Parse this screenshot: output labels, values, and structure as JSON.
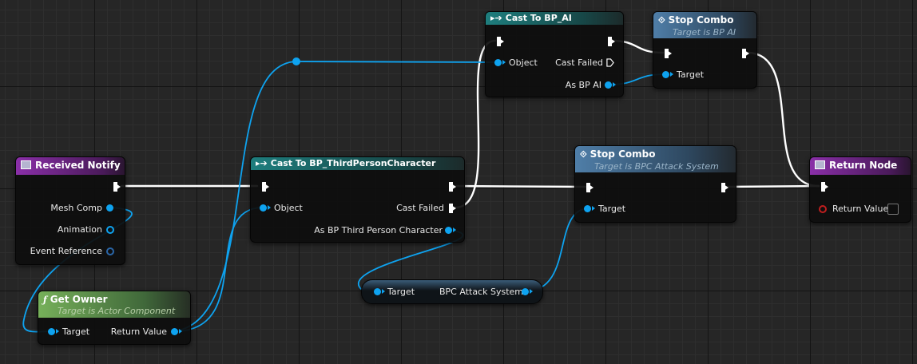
{
  "colors": {
    "object_pin": "#0ea3f0",
    "exec_pin": "#ffffff",
    "event_header": "#8a2fa8",
    "cast_header": "#1e7e7e",
    "function_header": "#4f7ea8",
    "pure_header": "#76b05a",
    "return_bool_pin": "#c01e1e"
  },
  "nodes": {
    "received_notify": {
      "title": "Received Notify",
      "icon": "event-icon",
      "pins": {
        "mesh_comp": "Mesh Comp",
        "animation": "Animation",
        "event_reference": "Event Reference"
      }
    },
    "get_owner": {
      "title": "Get Owner",
      "subtitle": "Target is Actor Component",
      "icon": "function-icon",
      "pins": {
        "target": "Target",
        "return_value": "Return Value"
      }
    },
    "cast_third_person": {
      "title": "Cast To BP_ThirdPersonCharacter",
      "icon": "cast-icon",
      "pins": {
        "object": "Object",
        "cast_failed": "Cast Failed",
        "as_bp": "As BP Third Person Character"
      }
    },
    "cast_ai": {
      "title": "Cast To BP_AI",
      "icon": "cast-icon",
      "pins": {
        "object": "Object",
        "cast_failed": "Cast Failed",
        "as_bp": "As BP AI"
      }
    },
    "stop_combo_ai": {
      "title": "Stop Combo",
      "subtitle": "Target is BP AI",
      "icon": "function-call-icon",
      "pins": {
        "target": "Target"
      }
    },
    "stop_combo_bpc": {
      "title": "Stop Combo",
      "subtitle": "Target is BPC Attack System",
      "icon": "function-call-icon",
      "pins": {
        "target": "Target"
      }
    },
    "bpc_attack_system": {
      "pins": {
        "target": "Target",
        "value": "BPC Attack System"
      }
    },
    "return_node": {
      "title": "Return Node",
      "icon": "return-icon",
      "pins": {
        "return_value": "Return Value"
      },
      "return_value_checked": false
    }
  }
}
